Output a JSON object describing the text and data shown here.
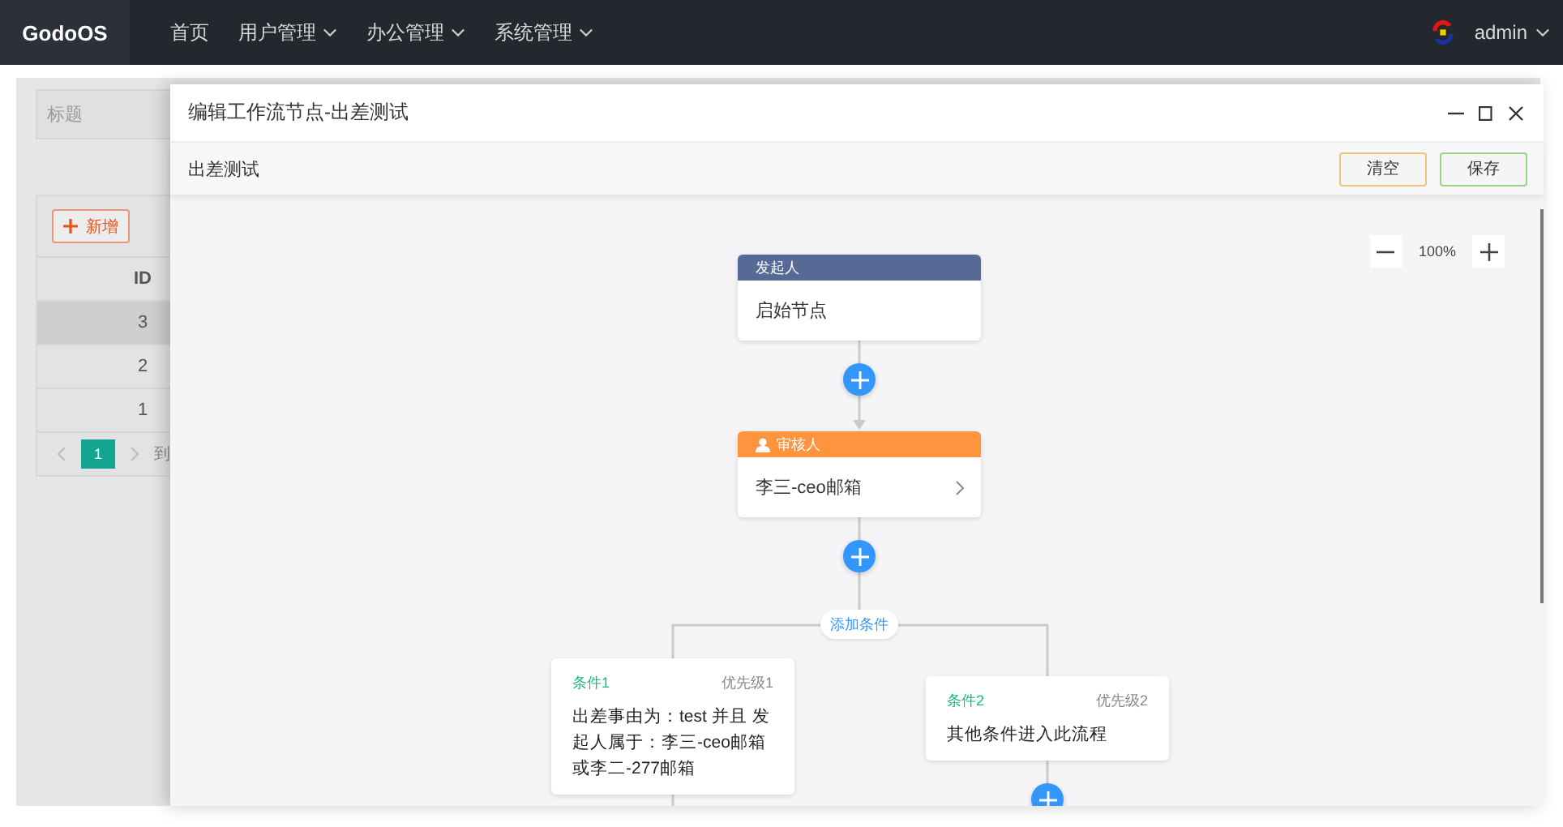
{
  "nav": {
    "brand": "GodoOS",
    "items": [
      {
        "label": "首页",
        "dropdown": false
      },
      {
        "label": "用户管理",
        "dropdown": true
      },
      {
        "label": "办公管理",
        "dropdown": true
      },
      {
        "label": "系统管理",
        "dropdown": true
      }
    ],
    "user": "admin"
  },
  "background_page": {
    "search": {
      "placeholder": "标题"
    },
    "add_button": "新增",
    "table": {
      "columns": [
        "ID"
      ],
      "rows": [
        {
          "id": "3",
          "highlighted": true
        },
        {
          "id": "2",
          "highlighted": false
        },
        {
          "id": "1",
          "highlighted": false
        }
      ]
    },
    "pagination": {
      "pages": [
        {
          "label": "1",
          "selected": true
        }
      ],
      "goto": "到"
    }
  },
  "dialog": {
    "title": "编辑工作流节点-出差测试",
    "toolbar_title": "出差测试",
    "buttons": [
      {
        "label": "清空",
        "kind": "reset"
      },
      {
        "label": "保存",
        "kind": "save"
      }
    ],
    "zoom": "100%",
    "flow": {
      "nodes": [
        {
          "kind": "start",
          "header": "发起人",
          "content": "启始节点"
        },
        {
          "kind": "approver",
          "header": "审核人",
          "content": "李三-ceo邮箱"
        }
      ],
      "add_condition": "添加条件",
      "conditions": [
        {
          "title": "条件1",
          "priority": "优先级1",
          "content": "出差事由为：test 并且 发起人属于：李三-ceo邮箱或李二-277邮箱"
        },
        {
          "title": "条件2",
          "priority": "优先级2",
          "content": "其他条件进入此流程"
        }
      ]
    }
  }
}
